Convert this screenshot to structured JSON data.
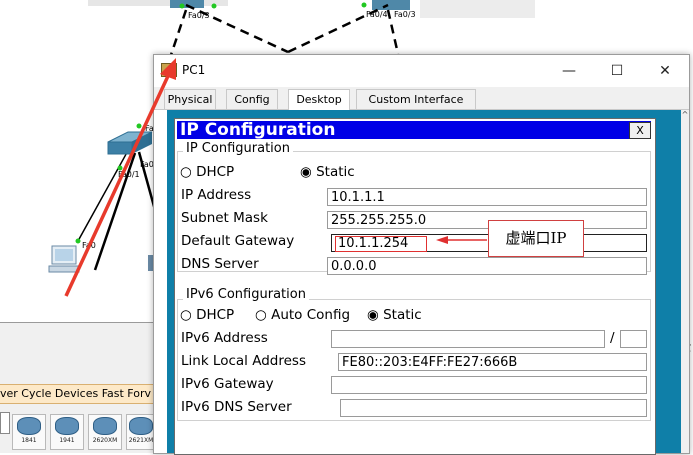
{
  "topology": {
    "ports": {
      "sw_top_fa03": "Fa0/3",
      "sw_top_fa04": "Fa0/4",
      "sw_top_fa03b": "Fa0/3",
      "sw_left_fa": "Fa",
      "sw_left_fa0": "Fa0",
      "sw_left_fa01": "Fa0/1",
      "pc_fa0": "Fa0"
    },
    "right_cut_letter": "t"
  },
  "device_panel": {
    "toolbar_text": "ver Cycle Devices  Fast Forv",
    "devices": [
      "1841",
      "1941",
      "2620XM",
      "2621XM"
    ]
  },
  "window": {
    "title": "PC1",
    "controls": {
      "minimize": "—",
      "maximize": "☐",
      "close": "✕"
    },
    "tabs": [
      "Physical",
      "Config",
      "Desktop",
      "Custom Interface"
    ],
    "active_tab": "Desktop"
  },
  "ip_config": {
    "title": "IP Configuration",
    "close_label": "X",
    "ipv4": {
      "group_label": "IP Configuration",
      "dhcp_label": "DHCP",
      "static_label": "Static",
      "selected": "Static",
      "ip_label": "IP Address",
      "ip_value": "10.1.1.1",
      "mask_label": "Subnet Mask",
      "mask_value": "255.255.255.0",
      "gw_label": "Default Gateway",
      "gw_value": "10.1.1.254",
      "dns_label": "DNS Server",
      "dns_value": "0.0.0.0"
    },
    "ipv6": {
      "group_label": "IPv6 Configuration",
      "dhcp_label": "DHCP",
      "auto_label": "Auto Config",
      "static_label": "Static",
      "selected": "Static",
      "addr_label": "IPv6 Address",
      "addr_value": "",
      "prefix_sep": "/",
      "prefix_value": "",
      "link_local_label": "Link Local Address",
      "link_local_value": "FE80::203:E4FF:FE27:666B",
      "gw_label": "IPv6 Gateway",
      "gw_value": "",
      "dns_label": "IPv6 DNS Server",
      "dns_value": ""
    }
  },
  "annotation": {
    "text": "虚端口IP",
    "color": "#e03030"
  },
  "colors": {
    "header_blue": "#0000e6",
    "frame_teal": "#0f7fa8",
    "arrow_red": "#e83a2c"
  }
}
